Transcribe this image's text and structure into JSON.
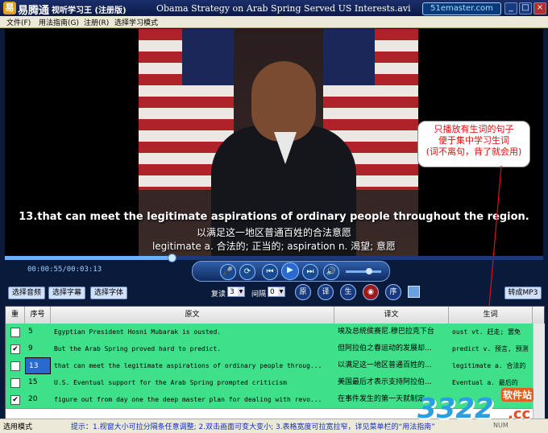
{
  "titlebar": {
    "app_name": "易腾通",
    "edition": "视听学习王 (注册版)",
    "file_title": "Obama Strategy on Arab Spring Served US Interests.avi",
    "brand": "51emaster.com",
    "min": "_",
    "max": "□",
    "close": "×"
  },
  "menu": [
    "文件(F)",
    "用法指南(G)",
    "注册(R)",
    "选择学习模式"
  ],
  "video": {
    "subtitle_en": "13.that can meet the legitimate aspirations of ordinary people throughout the region.",
    "subtitle_cn": "以满足这一地区普通百姓的合法意愿",
    "subtitle_def": "legitimate a. 合法的; 正当的; aspiration n. 渴望; 意愿"
  },
  "callout": {
    "line1": "只播放有生词的句子",
    "line2": "便于集中学习生词",
    "line3": "(词不离句，背了就会用)"
  },
  "player": {
    "time": "00:00:55/00:03:13",
    "progress": 0.31,
    "volume": 0.65,
    "buttons": [
      "选择音频",
      "选择字幕",
      "选择字体"
    ],
    "repeat_label": "复读",
    "repeat_value": "3",
    "interval_label": "间隔",
    "interval_value": "0",
    "mode_buttons": [
      "原",
      "译",
      "生",
      "",
      "序"
    ],
    "convert_mp3": "转成MP3"
  },
  "table": {
    "headers": [
      "重",
      "序号",
      "原文",
      "译文",
      "生词"
    ],
    "rows": [
      {
        "checked": false,
        "num": "5",
        "orig": "Egyptian President Hosni Mubarak is ousted.",
        "trans": "埃及总统侯赛尼.穆巴拉克下台",
        "vocab": "oust vt. 赶走; 罢免",
        "selected": false
      },
      {
        "checked": true,
        "num": "9",
        "orig": "But the Arab Spring proved hard to predict.",
        "trans": "但阿拉伯之春运动的发展却...",
        "vocab": "predict v. 预言, 预测",
        "selected": false
      },
      {
        "checked": false,
        "num": "13",
        "orig": "that can meet the legitimate aspirations of ordinary people throug...",
        "trans": "以满足这一地区普通百姓的...",
        "vocab": "legitimate a. 合法的",
        "selected": true
      },
      {
        "checked": false,
        "num": "15",
        "orig": "U.S. Eventual support for the Arab Spring prompted criticism",
        "trans": "美国最后才表示支持阿拉伯...",
        "vocab": "Eventual a. 最后的",
        "selected": false
      },
      {
        "checked": true,
        "num": "20",
        "orig": "figure out from day one the deep master plan for dealing with revo...",
        "trans": "在事件发生的第一天就制定...",
        "vocab": "",
        "selected": false
      }
    ]
  },
  "status": {
    "left": "选用模式",
    "tip": "提示：1.视窗大小可拉分隔条任意调整; 2.双击画面可变大变小; 3.表格宽度可拉宽拉窄，详见菜单栏的“用法指南”",
    "num": "NUM"
  },
  "watermark": {
    "big": "3322",
    "cc": ".cc",
    "small": "软件站"
  },
  "colors": {
    "row_bg": "#3ee08a",
    "callout_text": "#e01010",
    "titlebar": "#1b2f6b"
  }
}
